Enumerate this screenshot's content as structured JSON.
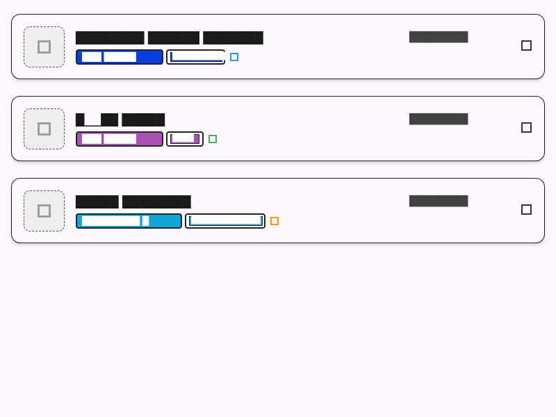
{
  "cards": [
    {
      "title": "████████  ██████  ███████",
      "timestamp": "██████████",
      "chip_label": "███ █████",
      "chip_secondary": "██████████",
      "chip_color": "#0a3de0",
      "dot_color": "#2196f3"
    },
    {
      "title": "█___██  █████",
      "timestamp": "██████████",
      "chip_label": "███ █████",
      "chip_secondary": "████",
      "chip_color": "#a853b3",
      "dot_color": "#4caf50"
    },
    {
      "title": "█████  ████████",
      "timestamp": "██████████",
      "chip_label": "█████████  █",
      "chip_secondary": "█████████████",
      "chip_color": "#10a6d8",
      "dot_color": "#ff9800"
    }
  ]
}
